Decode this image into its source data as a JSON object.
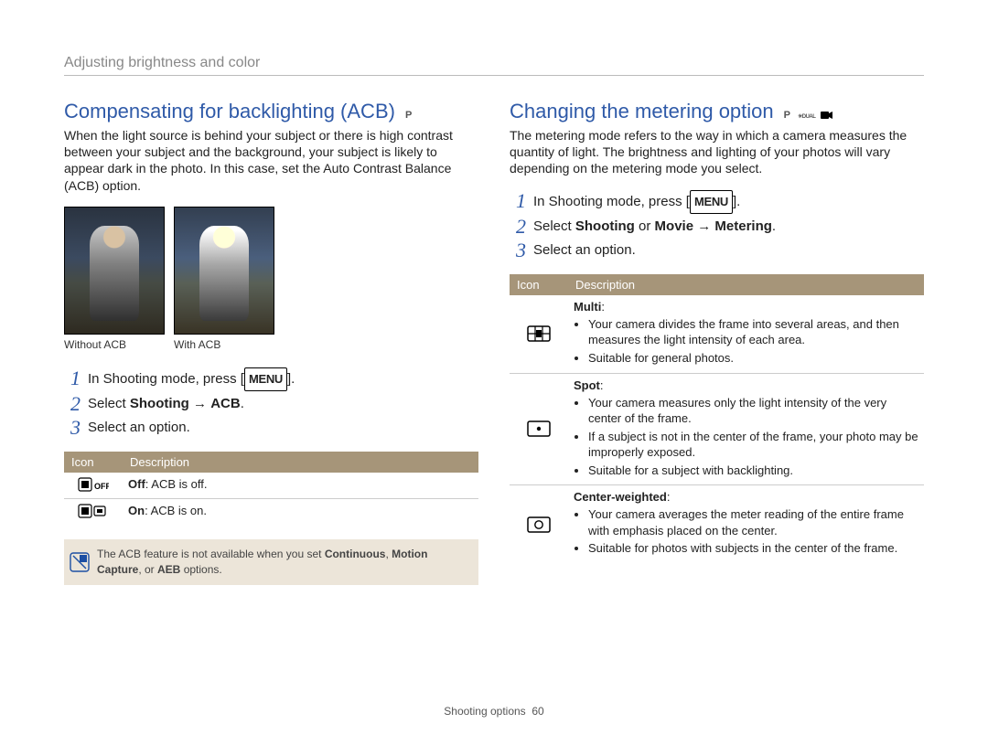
{
  "breadcrumb": "Adjusting brightness and color",
  "acb": {
    "heading": "Compensating for backlighting (ACB)",
    "modes": "P",
    "intro": "When the light source is behind your subject or there is high contrast between your subject and the background, your subject is likely to appear dark in the photo. In this case, set the Auto Contrast Balance (ACB) option.",
    "caption_without": "Without ACB",
    "caption_with": "With ACB",
    "steps": [
      {
        "num": "1",
        "pre": "In Shooting mode, press [",
        "menu": "MENU",
        "post": "]."
      },
      {
        "num": "2",
        "pre": "Select ",
        "bold1": "Shooting",
        "arrow": " → ",
        "bold2": "ACB",
        "post": "."
      },
      {
        "num": "3",
        "pre": "Select an option."
      }
    ],
    "table": {
      "head_icon": "Icon",
      "head_desc": "Description",
      "rows": [
        {
          "icon": "acb-off-icon",
          "label": "Off",
          "text": ": ACB is off."
        },
        {
          "icon": "acb-on-icon",
          "label": "On",
          "text": ": ACB is on."
        }
      ]
    },
    "note_html": "The ACB feature is not available when you set <b>Continuous</b>, <b>Motion Capture</b>, or <b>AEB</b> options."
  },
  "metering": {
    "heading": "Changing the metering option",
    "modes": "P  ᴰᵁᴬᴸ  ▶▶",
    "intro": "The metering mode refers to the way in which a camera measures the quantity of light. The brightness and lighting of your photos will vary depending on the metering mode you select.",
    "steps": [
      {
        "num": "1",
        "pre": "In Shooting mode, press [",
        "menu": "MENU",
        "post": "]."
      },
      {
        "num": "2",
        "pre": "Select ",
        "bold1": "Shooting",
        "mid": " or ",
        "bold2": "Movie",
        "arrow": " → ",
        "bold3": "Metering",
        "post": "."
      },
      {
        "num": "3",
        "pre": "Select an option."
      }
    ],
    "table": {
      "head_icon": "Icon",
      "head_desc": "Description",
      "rows": [
        {
          "icon": "multi-icon",
          "label": "Multi",
          "bullets": [
            "Your camera divides the frame into several areas, and then measures the light intensity of each area.",
            "Suitable for general photos."
          ]
        },
        {
          "icon": "spot-icon",
          "label": "Spot",
          "bullets": [
            "Your camera measures only the light intensity of the very center of the frame.",
            "If a subject is not in the center of the frame, your photo may be improperly exposed.",
            "Suitable for a subject with backlighting."
          ]
        },
        {
          "icon": "center-weighted-icon",
          "label": "Center-weighted",
          "bullets": [
            "Your camera averages the meter reading of the entire frame with emphasis placed on the center.",
            "Suitable for photos with subjects in the center of the frame."
          ]
        }
      ]
    }
  },
  "footer": {
    "section": "Shooting options",
    "page": "60"
  }
}
